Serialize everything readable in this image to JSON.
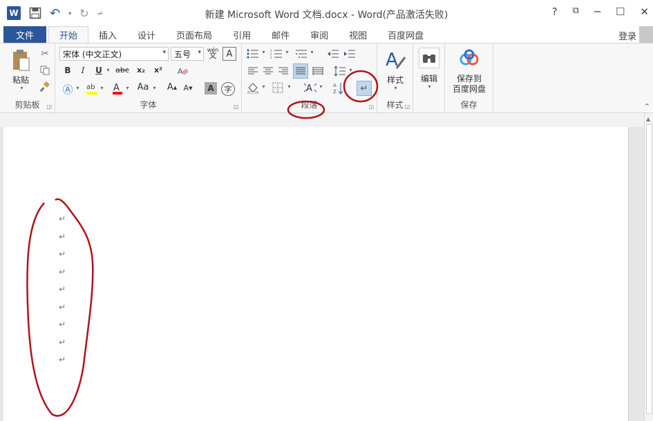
{
  "window": {
    "title": "新建 Microsoft Word 文档.docx - Word(产品激活失败)",
    "controls": [
      "?",
      "⧉",
      "─",
      "☐",
      "✕"
    ]
  },
  "qat": {
    "app_icon": "W",
    "undo": "↶",
    "redo": "↻",
    "customize": "⩫"
  },
  "tabs": {
    "file": "文件",
    "items": [
      "开始",
      "插入",
      "设计",
      "页面布局",
      "引用",
      "邮件",
      "审阅",
      "视图",
      "百度网盘"
    ],
    "active": "开始",
    "login": "登录"
  },
  "ribbon": {
    "clipboard": {
      "label": "剪贴板",
      "paste": "粘贴"
    },
    "font": {
      "label": "字体",
      "font_name": "宋体 (中文正文)",
      "font_size": "五号",
      "bold": "B",
      "italic": "I",
      "underline": "U",
      "strike": "abc",
      "subscript": "x₂",
      "superscript": "x²",
      "case": "Aa",
      "grow": "A",
      "shrink": "A",
      "char_shading": "A",
      "enclose": "字",
      "phonetic": "wén",
      "border_char": "A"
    },
    "paragraph": {
      "label": "段落"
    },
    "styles": {
      "label": "样式",
      "button": "样式"
    },
    "editing": {
      "button": "编辑"
    },
    "save": {
      "label": "保存",
      "button_line1": "保存到",
      "button_line2": "百度网盘"
    }
  },
  "colors": {
    "accent": "#2b579a",
    "annotation": "#b0121b",
    "highlight": "#ffff00",
    "font_color": "#ff0000"
  },
  "document": {
    "paragraph_mark": "↵",
    "mark_count": 9
  }
}
